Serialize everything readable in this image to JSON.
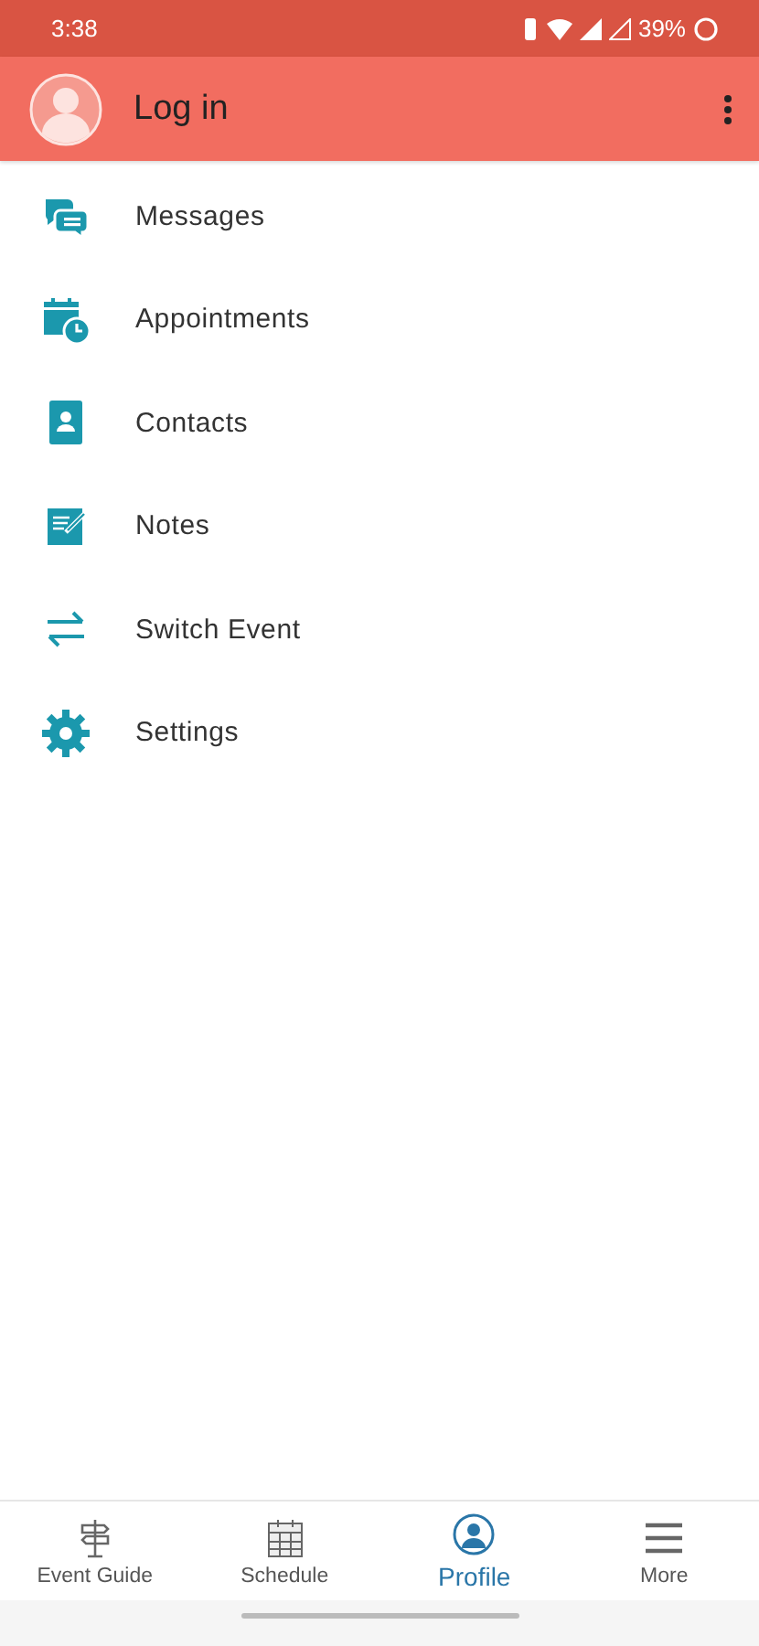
{
  "status_bar": {
    "time": "3:38",
    "battery": "39%"
  },
  "header": {
    "title": "Log in"
  },
  "menu": [
    {
      "kind": "messages",
      "label": "Messages"
    },
    {
      "kind": "appointments",
      "label": "Appointments"
    },
    {
      "kind": "contacts",
      "label": "Contacts"
    },
    {
      "kind": "notes",
      "label": "Notes"
    },
    {
      "kind": "switch",
      "label": "Switch Event"
    },
    {
      "kind": "settings",
      "label": "Settings"
    }
  ],
  "bottom_nav": [
    {
      "kind": "guide",
      "label": "Event Guide",
      "selected": false
    },
    {
      "kind": "schedule",
      "label": "Schedule",
      "selected": false
    },
    {
      "kind": "profile",
      "label": "Profile",
      "selected": true
    },
    {
      "kind": "more",
      "label": "More",
      "selected": false
    }
  ]
}
